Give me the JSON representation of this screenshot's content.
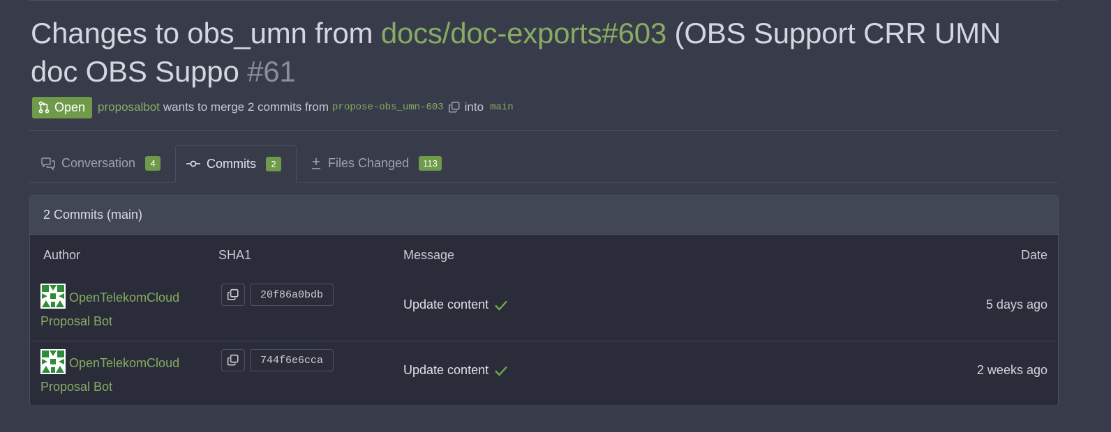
{
  "title": {
    "prefix": "Changes to obs_umn from ",
    "link": "docs/doc-exports#603",
    "suffix": " (OBS Support CRR UMN doc OBS Suppo ",
    "number": "#61"
  },
  "status": {
    "badge": "Open",
    "user": "proposalbot",
    "text": "wants to merge 2 commits from",
    "head_branch": "propose-obs_umn-603",
    "into": "into",
    "base_branch": "main"
  },
  "tabs": [
    {
      "label": "Conversation",
      "count": "4",
      "icon": "comment-icon"
    },
    {
      "label": "Commits",
      "count": "2",
      "icon": "commit-icon"
    },
    {
      "label": "Files Changed",
      "count": "113",
      "icon": "diff-icon"
    }
  ],
  "commits_box": {
    "header": "2 Commits (main)",
    "columns": {
      "author": "Author",
      "sha": "SHA1",
      "message": "Message",
      "date": "Date"
    },
    "rows": [
      {
        "author": "OpenTelekomCloud Proposal Bot",
        "sha": "20f86a0bdb",
        "message": "Update content",
        "date": "5 days ago"
      },
      {
        "author": "OpenTelekomCloud Proposal Bot",
        "sha": "744f6e6cca",
        "message": "Update content",
        "date": "2 weeks ago"
      }
    ]
  },
  "colors": {
    "background": "#383c4a",
    "accent_green": "#87ab63",
    "badge_green": "#6e9a4a"
  }
}
